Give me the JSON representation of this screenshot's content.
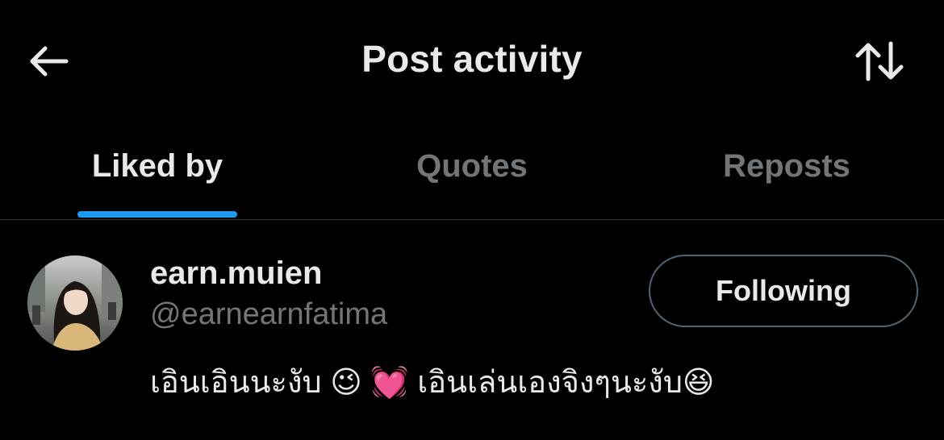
{
  "header": {
    "title": "Post activity",
    "back_icon": "arrow-left-icon",
    "sort_icon": "sort-arrows-icon"
  },
  "tabs": [
    {
      "label": "Liked by",
      "active": true
    },
    {
      "label": "Quotes",
      "active": false
    },
    {
      "label": "Reposts",
      "active": false
    }
  ],
  "user": {
    "display_name": "earn.muien",
    "handle": "@earnearnfatima",
    "bio": "เอินเอินนะงับ 😉 💓 เอินเล่นเองจิงๆนะงับ😆",
    "follow_state": "Following"
  },
  "colors": {
    "background": "#000000",
    "primary_text": "#e7e9ea",
    "secondary_text": "#71767b",
    "accent": "#1d9bf0",
    "divider": "#2f3336"
  }
}
